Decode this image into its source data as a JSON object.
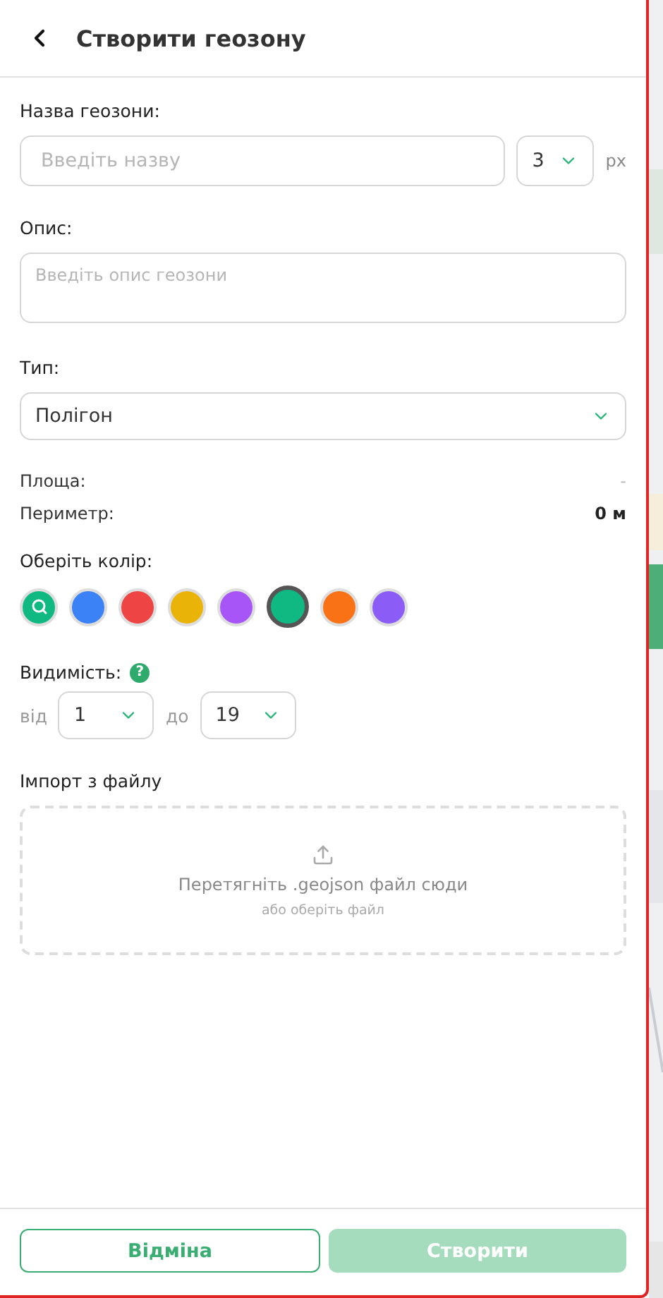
{
  "header": {
    "title": "Створити геозону"
  },
  "name_field": {
    "label": "Назва геозони:",
    "placeholder": "Введіть назву",
    "width_select": {
      "value": "3"
    },
    "unit": "px"
  },
  "description_field": {
    "label": "Опис:",
    "placeholder": "Введіть опис геозони"
  },
  "type_field": {
    "label": "Тип:",
    "value": "Полігон"
  },
  "stats": [
    {
      "label": "Площа:",
      "value": "-"
    },
    {
      "label": "Периметр:",
      "value": "0 м"
    }
  ],
  "color_picker": {
    "label": "Оберіть колір:",
    "colors": [
      {
        "kind": "picker",
        "color": "#10b981",
        "selected": false
      },
      {
        "kind": "swatch",
        "color": "#3b82f6",
        "selected": false
      },
      {
        "kind": "swatch",
        "color": "#ef4444",
        "selected": false
      },
      {
        "kind": "swatch",
        "color": "#eab308",
        "selected": false
      },
      {
        "kind": "swatch",
        "color": "#a855f7",
        "selected": false
      },
      {
        "kind": "swatch",
        "color": "#10b981",
        "selected": true
      },
      {
        "kind": "swatch",
        "color": "#f97316",
        "selected": false
      },
      {
        "kind": "swatch",
        "color": "#8b5cf6",
        "selected": false
      }
    ]
  },
  "visibility": {
    "label": "Видимість:",
    "help": "?",
    "from_label": "від",
    "from_value": "1",
    "to_label": "до",
    "to_value": "19"
  },
  "import": {
    "label": "Імпорт з файлу",
    "drop_text": "Перетягніть .geojson файл сюди",
    "hint": "або оберіть файл"
  },
  "footer": {
    "cancel": {
      "label": "Відміна",
      "disabled": false
    },
    "create": {
      "label": "Створити",
      "disabled": true
    }
  }
}
